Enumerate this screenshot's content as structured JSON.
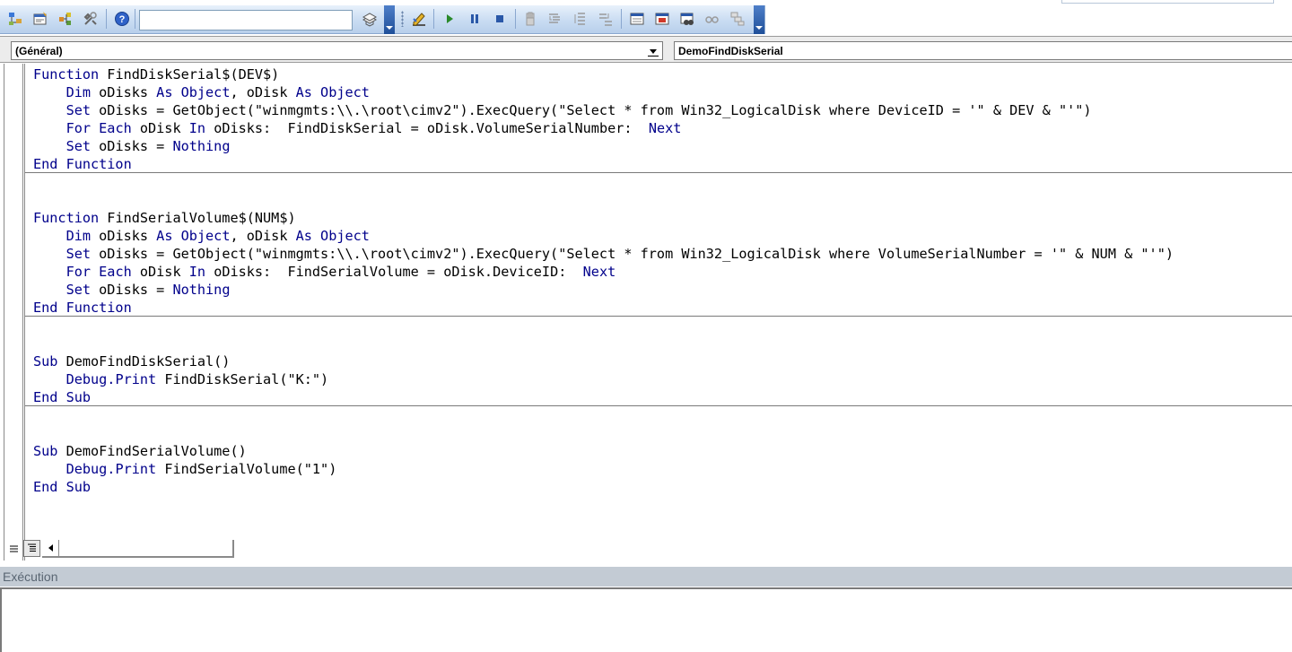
{
  "toolbar": {
    "search_value": "",
    "buttons": [
      "project-explorer-icon",
      "properties-icon",
      "object-browser-icon",
      "toolbox-icon",
      "help-icon",
      "references-icon",
      "design-mode-icon",
      "run-icon",
      "break-icon",
      "reset-icon",
      "toggle-breakpoint-icon",
      "step-into-icon",
      "step-over-icon",
      "step-out-icon",
      "locals-window-icon",
      "immediate-window-icon",
      "watch-window-icon",
      "quick-watch-icon",
      "call-stack-icon"
    ]
  },
  "procedure_bar": {
    "object_combo": "(Général)",
    "procedure_combo": "DemoFindDiskSerial"
  },
  "code": {
    "lines": [
      [
        {
          "k": true,
          "t": "Function"
        },
        {
          "t": " FindDiskSerial$(DEV$)"
        }
      ],
      [
        {
          "t": "    "
        },
        {
          "k": true,
          "t": "Dim"
        },
        {
          "t": " oDisks "
        },
        {
          "k": true,
          "t": "As Object"
        },
        {
          "t": ", oDisk "
        },
        {
          "k": true,
          "t": "As Object"
        }
      ],
      [
        {
          "t": "    "
        },
        {
          "k": true,
          "t": "Set"
        },
        {
          "t": " oDisks = GetObject(\"winmgmts:\\\\.\\root\\cimv2\").ExecQuery(\"Select * from Win32_LogicalDisk where DeviceID = '\" & DEV & \"'\")"
        }
      ],
      [
        {
          "t": "    "
        },
        {
          "k": true,
          "t": "For Each"
        },
        {
          "t": " oDisk "
        },
        {
          "k": true,
          "t": "In"
        },
        {
          "t": " oDisks:  FindDiskSerial = oDisk.VolumeSerialNumber:  "
        },
        {
          "k": true,
          "t": "Next"
        }
      ],
      [
        {
          "t": "    "
        },
        {
          "k": true,
          "t": "Set"
        },
        {
          "t": " oDisks = "
        },
        {
          "k": true,
          "t": "Nothing"
        }
      ],
      [
        {
          "k": true,
          "t": "End Function"
        }
      ],
      [],
      [],
      [
        {
          "k": true,
          "t": "Function"
        },
        {
          "t": " FindSerialVolume$(NUM$)"
        }
      ],
      [
        {
          "t": "    "
        },
        {
          "k": true,
          "t": "Dim"
        },
        {
          "t": " oDisks "
        },
        {
          "k": true,
          "t": "As Object"
        },
        {
          "t": ", oDisk "
        },
        {
          "k": true,
          "t": "As Object"
        }
      ],
      [
        {
          "t": "    "
        },
        {
          "k": true,
          "t": "Set"
        },
        {
          "t": " oDisks = GetObject(\"winmgmts:\\\\.\\root\\cimv2\").ExecQuery(\"Select * from Win32_LogicalDisk where VolumeSerialNumber = '\" & NUM & \"'\")"
        }
      ],
      [
        {
          "t": "    "
        },
        {
          "k": true,
          "t": "For Each"
        },
        {
          "t": " oDisk "
        },
        {
          "k": true,
          "t": "In"
        },
        {
          "t": " oDisks:  FindSerialVolume = oDisk.DeviceID:  "
        },
        {
          "k": true,
          "t": "Next"
        }
      ],
      [
        {
          "t": "    "
        },
        {
          "k": true,
          "t": "Set"
        },
        {
          "t": " oDisks = "
        },
        {
          "k": true,
          "t": "Nothing"
        }
      ],
      [
        {
          "k": true,
          "t": "End Function"
        }
      ],
      [],
      [],
      [
        {
          "k": true,
          "t": "Sub"
        },
        {
          "t": " DemoFindDiskSerial()"
        }
      ],
      [
        {
          "t": "    "
        },
        {
          "k": true,
          "t": "Debug.Print"
        },
        {
          "t": " FindDiskSerial(\"K:\")"
        }
      ],
      [
        {
          "k": true,
          "t": "End Sub"
        }
      ],
      [],
      [],
      [
        {
          "k": true,
          "t": "Sub"
        },
        {
          "t": " DemoFindSerialVolume()"
        }
      ],
      [
        {
          "t": "    "
        },
        {
          "k": true,
          "t": "Debug.Print"
        },
        {
          "t": " FindSerialVolume(\"1\")"
        }
      ],
      [
        {
          "k": true,
          "t": "End Sub"
        }
      ]
    ]
  },
  "immediate": {
    "title": "Exécution",
    "content": ""
  },
  "colors": {
    "keyword": "#00008b",
    "toolbar_gradient_top": "#e8f1fb",
    "toolbar_gradient_bottom": "#b8cfeb",
    "immediate_title_bg": "#c3cbd4"
  }
}
